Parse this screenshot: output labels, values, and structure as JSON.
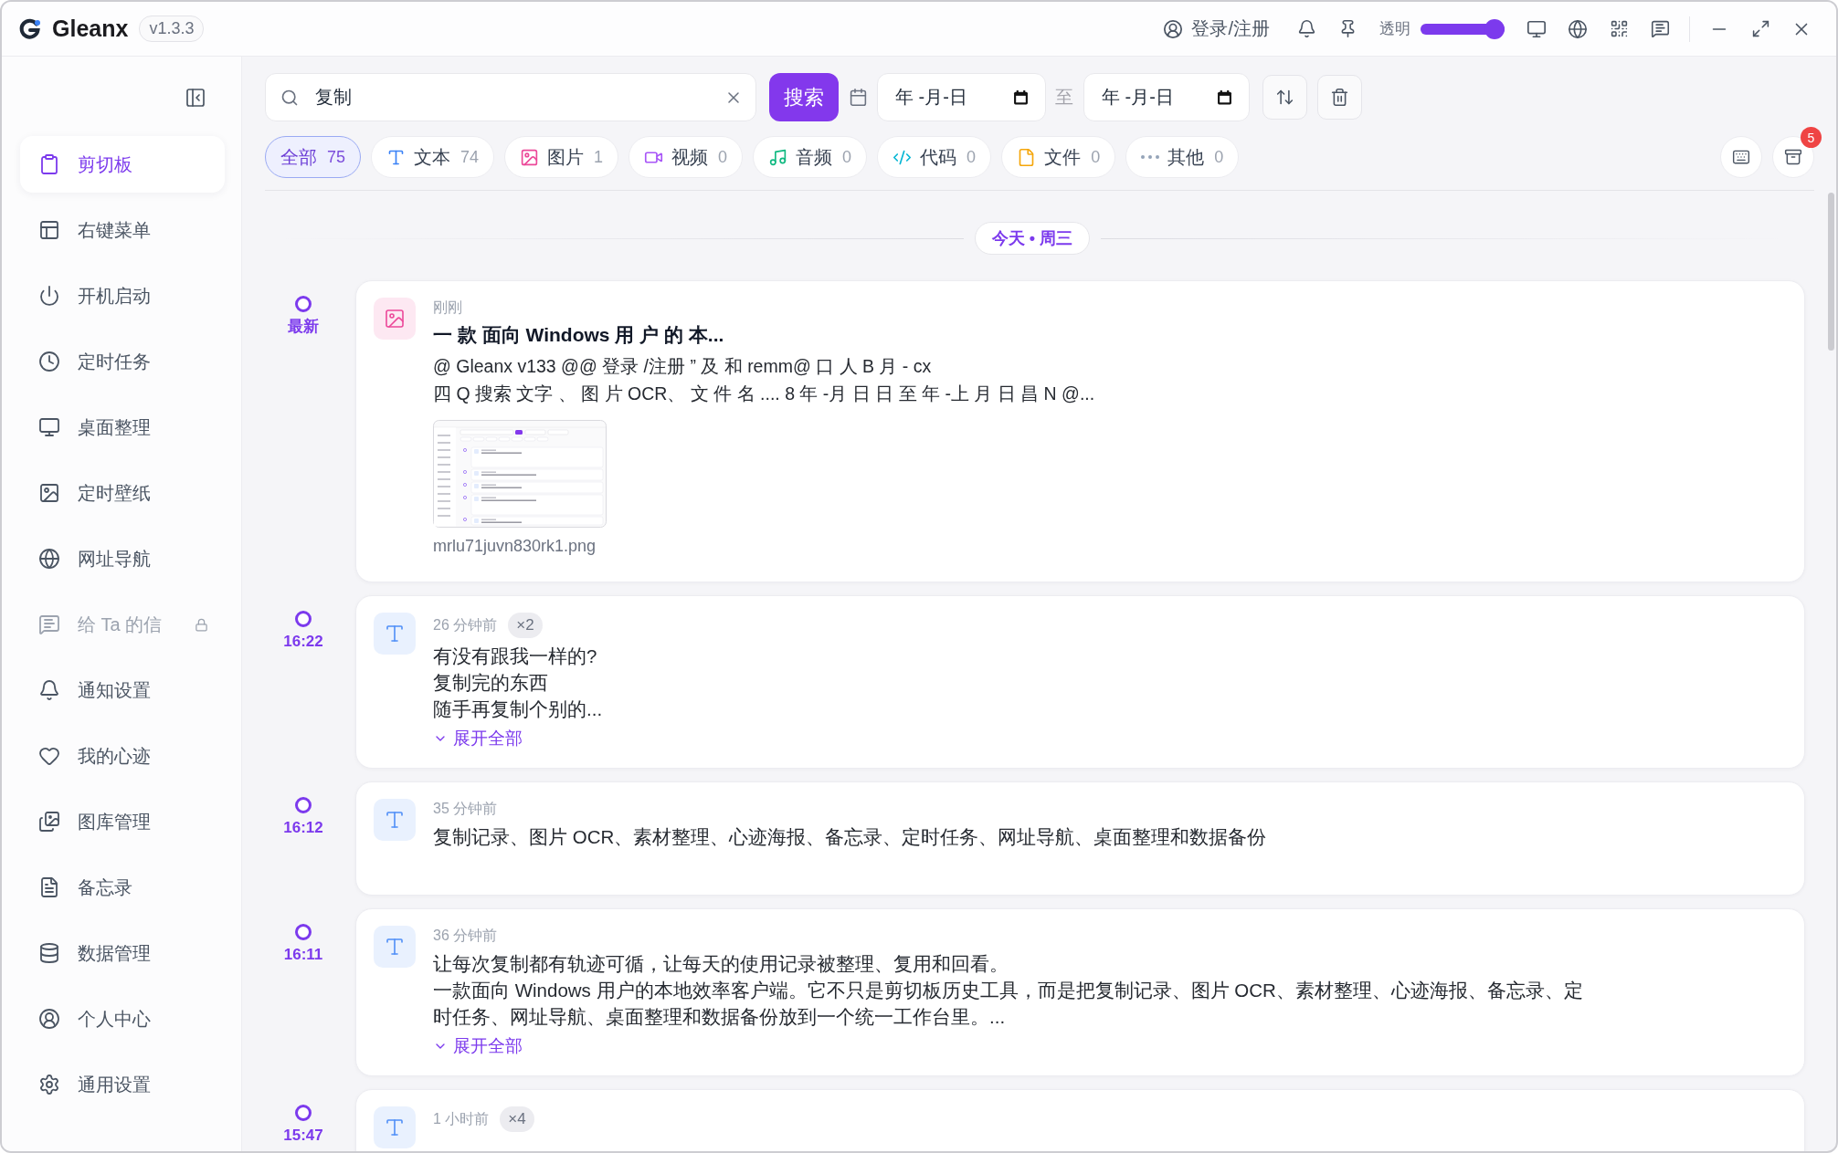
{
  "window": {
    "app_name": "Gleanx",
    "version": "v1.3.3"
  },
  "title_bar": {
    "account_label": "登录/注册",
    "opacity_label": "透明",
    "opacity_slider": {
      "level": 1
    }
  },
  "sidebar": {
    "items": [
      {
        "label": "剪切板",
        "selected": true,
        "locked": false
      },
      {
        "label": "右键菜单",
        "selected": false,
        "locked": false
      },
      {
        "label": "开机启动",
        "selected": false,
        "locked": false
      },
      {
        "label": "定时任务",
        "selected": false,
        "locked": false
      },
      {
        "label": "桌面整理",
        "selected": false,
        "locked": false
      },
      {
        "label": "定时壁纸",
        "selected": false,
        "locked": false
      },
      {
        "label": "网址导航",
        "selected": false,
        "locked": false
      },
      {
        "label": "给 Ta 的信",
        "selected": false,
        "locked": true
      },
      {
        "label": "通知设置",
        "selected": false,
        "locked": false
      },
      {
        "label": "我的心迹",
        "selected": false,
        "locked": false
      },
      {
        "label": "图库管理",
        "selected": false,
        "locked": false
      },
      {
        "label": "备忘录",
        "selected": false,
        "locked": false
      },
      {
        "label": "数据管理",
        "selected": false,
        "locked": false
      },
      {
        "label": "个人中心",
        "selected": false,
        "locked": false
      },
      {
        "label": "通用设置",
        "selected": false,
        "locked": false
      }
    ]
  },
  "toolbar": {
    "search": {
      "value": "复制"
    },
    "search_button": "搜索",
    "date_from": {
      "placeholder": "年 -月-日"
    },
    "range_separator": "至",
    "date_to": {
      "placeholder": "年 -月-日"
    }
  },
  "filters": [
    {
      "label": "全部",
      "count": "75",
      "selected": true
    },
    {
      "label": "文本",
      "count": "74",
      "selected": false
    },
    {
      "label": "图片",
      "count": "1",
      "selected": false
    },
    {
      "label": "视频",
      "count": "0",
      "selected": false
    },
    {
      "label": "音频",
      "count": "0",
      "selected": false
    },
    {
      "label": "代码",
      "count": "0",
      "selected": false
    },
    {
      "label": "文件",
      "count": "0",
      "selected": false
    },
    {
      "label": "其他",
      "count": "0",
      "selected": false
    }
  ],
  "archive_badge": "5",
  "date_divider": "今天 • 周三",
  "entries": [
    {
      "kind": "image",
      "marker": "最新",
      "time_ago": "刚刚",
      "title": "一 款 面向 Windows 用 户 的 本...",
      "lines": [
        "@ Gleanx v133 @@ 登录 /注册 ” 及 和 remm@ 口 人 B 月 - cx",
        "四 Q 搜索 文字 、 图 片 OCR、 文 件 名 .... 8 年 -月 日 日 至 年 -上 月 日 昌 N @..."
      ],
      "file_name": "mrlu71juvn830rk1.png"
    },
    {
      "kind": "text",
      "marker": "16:22",
      "time_ago": "26 分钟前",
      "repeat": "×2",
      "lines": [
        "有没有跟我一样的?",
        "复制完的东西",
        "随手再复制个别的..."
      ],
      "expand_label": "展开全部"
    },
    {
      "kind": "text",
      "marker": "16:12",
      "time_ago": "35 分钟前",
      "lines": [
        "复制记录、图片 OCR、素材整理、心迹海报、备忘录、定时任务、网址导航、桌面整理和数据备份"
      ]
    },
    {
      "kind": "text",
      "marker": "16:11",
      "time_ago": "36 分钟前",
      "lines": [
        "让每次复制都有轨迹可循，让每天的使用记录被整理、复用和回看。",
        "一款面向 Windows 用户的本地效率客户端。它不只是剪切板历史工具，而是把复制记录、图片 OCR、素材整理、心迹海报、备忘录、定时任务、网址导航、桌面整理和数据备份放到一个统一工作台里。..."
      ],
      "expand_label": "展开全部"
    },
    {
      "kind": "text",
      "marker": "15:47",
      "time_ago": "1 小时前",
      "repeat": "×4"
    }
  ]
}
